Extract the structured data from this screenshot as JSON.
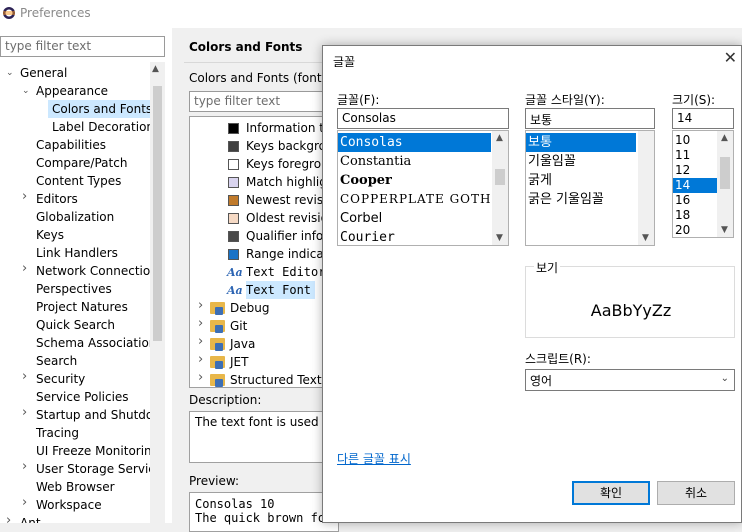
{
  "window": {
    "title": "Preferences"
  },
  "left": {
    "filter_placeholder": "type filter text",
    "tree": [
      {
        "label": "General",
        "indent": 0,
        "chev": "down"
      },
      {
        "label": "Appearance",
        "indent": 1,
        "chev": "down"
      },
      {
        "label": "Colors and Fonts",
        "indent": 2,
        "chev": "",
        "selected": true
      },
      {
        "label": "Label Decorations",
        "indent": 2,
        "chev": ""
      },
      {
        "label": "Capabilities",
        "indent": 1,
        "chev": ""
      },
      {
        "label": "Compare/Patch",
        "indent": 1,
        "chev": ""
      },
      {
        "label": "Content Types",
        "indent": 1,
        "chev": ""
      },
      {
        "label": "Editors",
        "indent": 1,
        "chev": "right"
      },
      {
        "label": "Globalization",
        "indent": 1,
        "chev": ""
      },
      {
        "label": "Keys",
        "indent": 1,
        "chev": ""
      },
      {
        "label": "Link Handlers",
        "indent": 1,
        "chev": ""
      },
      {
        "label": "Network Connections",
        "indent": 1,
        "chev": "right"
      },
      {
        "label": "Perspectives",
        "indent": 1,
        "chev": ""
      },
      {
        "label": "Project Natures",
        "indent": 1,
        "chev": ""
      },
      {
        "label": "Quick Search",
        "indent": 1,
        "chev": ""
      },
      {
        "label": "Schema Associations",
        "indent": 1,
        "chev": ""
      },
      {
        "label": "Search",
        "indent": 1,
        "chev": ""
      },
      {
        "label": "Security",
        "indent": 1,
        "chev": "right"
      },
      {
        "label": "Service Policies",
        "indent": 1,
        "chev": ""
      },
      {
        "label": "Startup and Shutdown",
        "indent": 1,
        "chev": "right"
      },
      {
        "label": "Tracing",
        "indent": 1,
        "chev": ""
      },
      {
        "label": "UI Freeze Monitoring",
        "indent": 1,
        "chev": ""
      },
      {
        "label": "User Storage Service",
        "indent": 1,
        "chev": "right"
      },
      {
        "label": "Web Browser",
        "indent": 1,
        "chev": ""
      },
      {
        "label": "Workspace",
        "indent": 1,
        "chev": "right"
      },
      {
        "label": "Ant",
        "indent": 0,
        "chev": "right"
      }
    ]
  },
  "main": {
    "heading": "Colors and Fonts",
    "description_line": "Colors and Fonts (font, size",
    "filter_placeholder": "type filter text",
    "items": [
      {
        "kind": "swatch",
        "color": "#000000",
        "label": "Information text"
      },
      {
        "kind": "swatch",
        "color": "#3f3f3f",
        "label": "Keys background"
      },
      {
        "kind": "swatch",
        "color": "#ffffff",
        "label": "Keys foreground"
      },
      {
        "kind": "swatch",
        "color": "#d9d4ef",
        "label": "Match highlight"
      },
      {
        "kind": "swatch",
        "color": "#c07a2b",
        "label": "Newest revision"
      },
      {
        "kind": "swatch",
        "color": "#f5d9c4",
        "label": "Oldest revision"
      },
      {
        "kind": "swatch",
        "color": "#4a4a4a",
        "label": "Qualifier information"
      },
      {
        "kind": "swatch",
        "color": "#1a73c7",
        "label": "Range indicator"
      },
      {
        "kind": "font",
        "label": "Text Editor"
      },
      {
        "kind": "font",
        "label": "Text Font",
        "selected": true
      },
      {
        "kind": "folder",
        "label": "Debug"
      },
      {
        "kind": "folder",
        "label": "Git"
      },
      {
        "kind": "folder",
        "label": "Java"
      },
      {
        "kind": "folder",
        "label": "JET"
      },
      {
        "kind": "folder",
        "label": "Structured Text Editors"
      }
    ],
    "description_label": "Description:",
    "description_text": "The text font is used by text editors.",
    "preview_label": "Preview:",
    "preview_line1": "Consolas 10",
    "preview_line2": "The quick brown fox jumps over the lazy dog."
  },
  "dialog": {
    "title": "글꼴",
    "font_label": "글꼴(F):",
    "font_value": "Consolas",
    "fonts": [
      "Consolas",
      "Constantia",
      "Cooper",
      "COPPERPLATE GOTHIC",
      "Corbel",
      "Courier"
    ],
    "style_label": "글꼴 스타일(Y):",
    "style_value": "보통",
    "styles": [
      "보통",
      "기울임꼴",
      "굵게",
      "굵은 기울임꼴"
    ],
    "size_label": "크기(S):",
    "size_value": "14",
    "sizes": [
      "10",
      "11",
      "12",
      "14",
      "16",
      "18",
      "20"
    ],
    "sample_label": "보기",
    "sample_text": "AaBbYyZz",
    "script_label": "스크립트(R):",
    "script_value": "영어",
    "more_fonts_link": "다른 글꼴 표시",
    "ok_label": "확인",
    "cancel_label": "취소"
  }
}
